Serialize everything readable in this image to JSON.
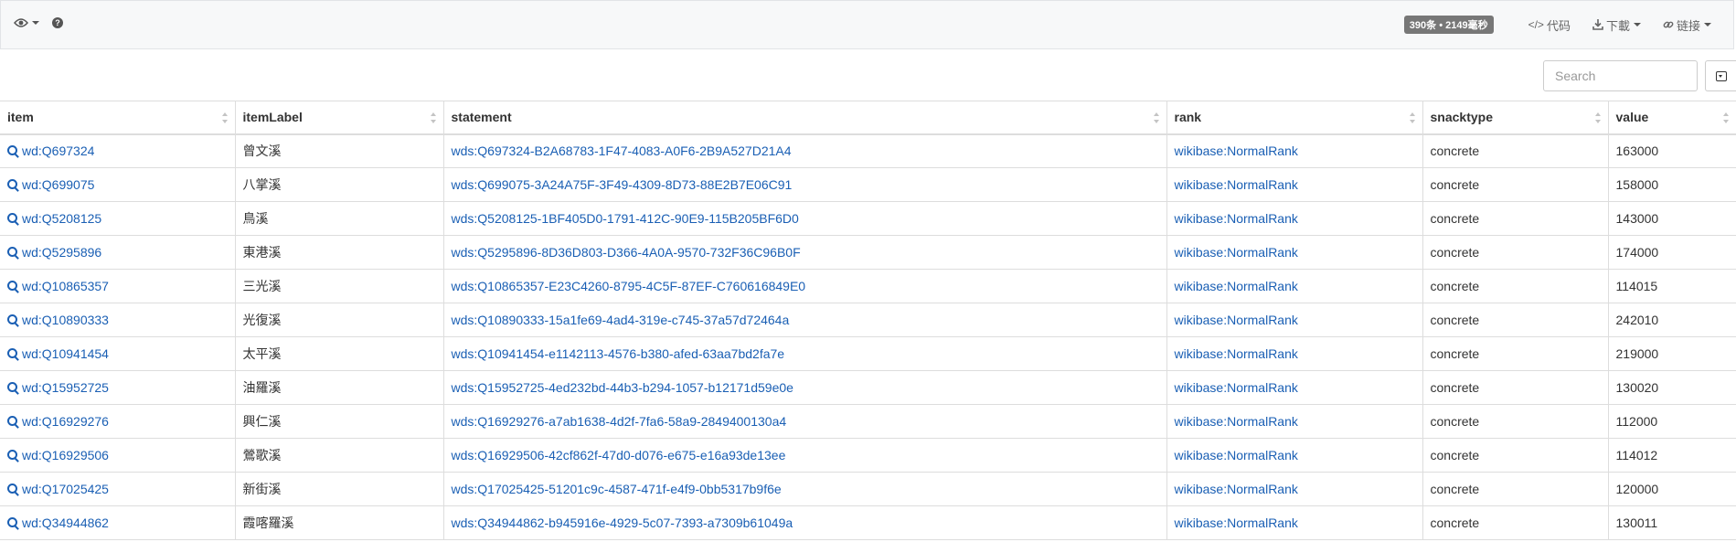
{
  "toolbar": {
    "result_badge": "390条 • 2149毫秒",
    "code_label": "代码",
    "download_label": "下載",
    "link_label": "链接"
  },
  "search": {
    "placeholder": "Search"
  },
  "table": {
    "headers": [
      "item",
      "itemLabel",
      "statement",
      "rank",
      "snacktype",
      "value"
    ],
    "rows": [
      {
        "item": "wd:Q697324",
        "itemLabel": "曾文溪",
        "statement": "wds:Q697324-B2A68783-1F47-4083-A0F6-2B9A527D21A4",
        "rank": "wikibase:NormalRank",
        "snacktype": "concrete",
        "value": "163000"
      },
      {
        "item": "wd:Q699075",
        "itemLabel": "八掌溪",
        "statement": "wds:Q699075-3A24A75F-3F49-4309-8D73-88E2B7E06C91",
        "rank": "wikibase:NormalRank",
        "snacktype": "concrete",
        "value": "158000"
      },
      {
        "item": "wd:Q5208125",
        "itemLabel": "鳥溪",
        "statement": "wds:Q5208125-1BF405D0-1791-412C-90E9-115B205BF6D0",
        "rank": "wikibase:NormalRank",
        "snacktype": "concrete",
        "value": "143000"
      },
      {
        "item": "wd:Q5295896",
        "itemLabel": "東港溪",
        "statement": "wds:Q5295896-8D36D803-D366-4A0A-9570-732F36C96B0F",
        "rank": "wikibase:NormalRank",
        "snacktype": "concrete",
        "value": "174000"
      },
      {
        "item": "wd:Q10865357",
        "itemLabel": "三光溪",
        "statement": "wds:Q10865357-E23C4260-8795-4C5F-87EF-C760616849E0",
        "rank": "wikibase:NormalRank",
        "snacktype": "concrete",
        "value": "114015"
      },
      {
        "item": "wd:Q10890333",
        "itemLabel": "光復溪",
        "statement": "wds:Q10890333-15a1fe69-4ad4-319e-c745-37a57d72464a",
        "rank": "wikibase:NormalRank",
        "snacktype": "concrete",
        "value": "242010"
      },
      {
        "item": "wd:Q10941454",
        "itemLabel": "太平溪",
        "statement": "wds:Q10941454-e1142113-4576-b380-afed-63aa7bd2fa7e",
        "rank": "wikibase:NormalRank",
        "snacktype": "concrete",
        "value": "219000"
      },
      {
        "item": "wd:Q15952725",
        "itemLabel": "油羅溪",
        "statement": "wds:Q15952725-4ed232bd-44b3-b294-1057-b12171d59e0e",
        "rank": "wikibase:NormalRank",
        "snacktype": "concrete",
        "value": "130020"
      },
      {
        "item": "wd:Q16929276",
        "itemLabel": "興仁溪",
        "statement": "wds:Q16929276-a7ab1638-4d2f-7fa6-58a9-2849400130a4",
        "rank": "wikibase:NormalRank",
        "snacktype": "concrete",
        "value": "112000"
      },
      {
        "item": "wd:Q16929506",
        "itemLabel": "鶯歌溪",
        "statement": "wds:Q16929506-42cf862f-47d0-d076-e675-e16a93de13ee",
        "rank": "wikibase:NormalRank",
        "snacktype": "concrete",
        "value": "114012"
      },
      {
        "item": "wd:Q17025425",
        "itemLabel": "新街溪",
        "statement": "wds:Q17025425-51201c9c-4587-471f-e4f9-0bb5317b9f6e",
        "rank": "wikibase:NormalRank",
        "snacktype": "concrete",
        "value": "120000"
      },
      {
        "item": "wd:Q34944862",
        "itemLabel": "霞喀羅溪",
        "statement": "wds:Q34944862-b945916e-4929-5c07-7393-a7309b61049a",
        "rank": "wikibase:NormalRank",
        "snacktype": "concrete",
        "value": "130011"
      }
    ]
  },
  "icons": {
    "view": "eye-icon",
    "help": "question-icon",
    "code": "code-icon",
    "download": "download-icon",
    "link": "link-icon",
    "explore": "magnifier-icon",
    "columns": "columns-toggle-icon"
  },
  "colors": {
    "link": "#1a5fb4",
    "badge": "#777777",
    "toolbar_bg": "#f7f8f9"
  }
}
